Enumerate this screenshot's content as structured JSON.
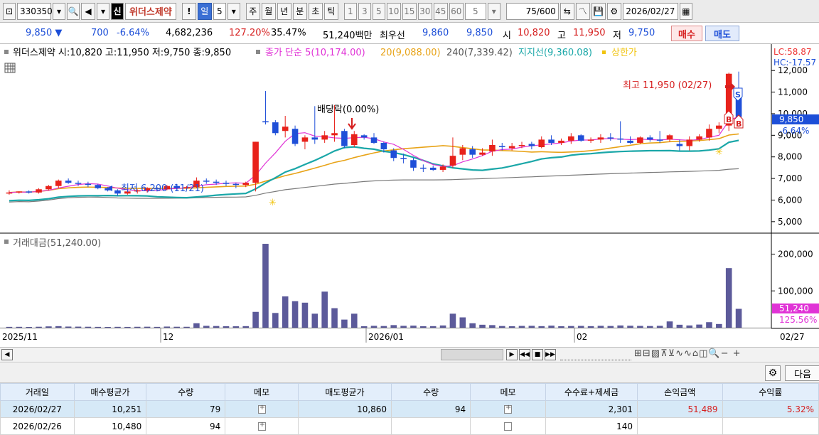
{
  "toolbar": {
    "code": "330350",
    "market_badge": "신",
    "stock_name": "위더스제약",
    "alert": "!",
    "period_day": "일",
    "period_value": "5",
    "periods": [
      "주",
      "월",
      "년",
      "분",
      "초",
      "틱"
    ],
    "intervals": [
      "1",
      "3",
      "5",
      "10",
      "15",
      "30",
      "45",
      "60"
    ],
    "custom_interval": "5",
    "count": "75",
    "count_total": "/600",
    "date": "2026/02/27"
  },
  "price": {
    "current": "9,850",
    "change": "700",
    "change_pct": "-6.64%",
    "volume": "4,682,236",
    "volume_ratio": "127.20%",
    "turnover": "35.47%",
    "amount": "51,240백만",
    "ask_label": "최우선",
    "ask": "9,860",
    "bid": "9,850",
    "open_label": "시",
    "open": "10,820",
    "high_label": "고",
    "high": "11,950",
    "low_label": "저",
    "low": "9,750",
    "buy_button": "매수",
    "sell_button": "매도"
  },
  "chart": {
    "header_name": "위더스제약 시:10,820 고:11,950 저:9,750 종:9,850",
    "legend_ma": "종가 단순 5(10,174.00)",
    "legend_ma20": "20(9,088.00)",
    "legend_ma240": "240(7,339.42)",
    "legend_support": "지지선(9,360.08)",
    "legend_upper": "상한가",
    "lc": "LC:58.87",
    "hc": "HC:-17.57",
    "annotation_high": "최고 11,950 (02/27)",
    "annotation_low": "최저 6,200 (11/21)",
    "annotation_dividend": "배당락(0.00%)",
    "price_tag": "9,850",
    "price_tag_pct": "-6.64%",
    "volume_header": "거래대금(51,240.00)",
    "volume_tag": "51,240",
    "volume_tag_pct": "125.56%",
    "x_last_label": "02/27",
    "colors": {
      "up": "#e8221b",
      "down": "#1f4fd8",
      "ma5": "#e033d6",
      "ma20": "#e8a317",
      "ma240": "#7a7a7a",
      "support": "#1aa7a8",
      "volume": "#5c5a9a"
    }
  },
  "chart_data": {
    "type": "candlestick",
    "price_axis_ticks": [
      "12,000",
      "11,000",
      "10,000",
      "9,000",
      "8,000",
      "7,000",
      "6,000",
      "5,000"
    ],
    "price_ylim": [
      4600,
      12500
    ],
    "volume_axis_ticks": [
      "200,000",
      "100,000"
    ],
    "volume_ylim": [
      0,
      230000
    ],
    "x_labels": [
      "2025/11",
      "12",
      "2026/01",
      "02"
    ],
    "candles": [
      [
        6350,
        6450,
        6250,
        6350
      ],
      [
        6350,
        6400,
        6300,
        6400
      ],
      [
        6400,
        6450,
        6300,
        6350
      ],
      [
        6350,
        6550,
        6300,
        6500
      ],
      [
        6500,
        6700,
        6450,
        6650
      ],
      [
        6650,
        6950,
        6550,
        6900
      ],
      [
        6900,
        7000,
        6750,
        6800
      ],
      [
        6800,
        6900,
        6650,
        6750
      ],
      [
        6750,
        6850,
        6600,
        6700
      ],
      [
        6700,
        6750,
        6500,
        6550
      ],
      [
        6550,
        6600,
        6400,
        6450
      ],
      [
        6450,
        6500,
        6200,
        6300
      ],
      [
        6300,
        6450,
        6250,
        6400
      ],
      [
        6400,
        6500,
        6300,
        6450
      ],
      [
        6450,
        6600,
        6350,
        6550
      ],
      [
        6550,
        6600,
        6400,
        6500
      ],
      [
        6500,
        6700,
        6450,
        6650
      ],
      [
        6650,
        6750,
        6500,
        6550
      ],
      [
        6550,
        6650,
        6450,
        6600
      ],
      [
        6600,
        7050,
        6550,
        6900
      ],
      [
        6900,
        7000,
        6750,
        6850
      ],
      [
        6850,
        6950,
        6700,
        6800
      ],
      [
        6800,
        6900,
        6650,
        6750
      ],
      [
        6750,
        6800,
        6550,
        6700
      ],
      [
        6700,
        6850,
        6600,
        6800
      ],
      [
        6800,
        8700,
        6400,
        8700
      ],
      [
        9650,
        11050,
        9500,
        9600
      ],
      [
        9600,
        9700,
        9000,
        9100
      ],
      [
        9200,
        9900,
        8900,
        9400
      ],
      [
        9300,
        9450,
        8500,
        8600
      ],
      [
        8700,
        9000,
        8350,
        8900
      ],
      [
        8900,
        10350,
        8600,
        8800
      ],
      [
        8800,
        9200,
        8650,
        9000
      ],
      [
        9000,
        10400,
        8700,
        9100
      ],
      [
        9200,
        9300,
        8400,
        8500
      ],
      [
        8550,
        9200,
        8450,
        9050
      ],
      [
        9000,
        9050,
        8800,
        8900
      ],
      [
        8900,
        9100,
        8600,
        8650
      ],
      [
        8650,
        8700,
        8200,
        8350
      ],
      [
        8300,
        8400,
        7800,
        7950
      ],
      [
        7950,
        8150,
        7700,
        7900
      ],
      [
        7850,
        7950,
        7350,
        7500
      ],
      [
        7500,
        7650,
        7300,
        7450
      ],
      [
        7500,
        7600,
        7350,
        7400
      ],
      [
        7400,
        7650,
        7300,
        7550
      ],
      [
        7600,
        8900,
        7500,
        8050
      ],
      [
        8100,
        8550,
        7850,
        8400
      ],
      [
        8350,
        8500,
        7950,
        8100
      ],
      [
        8100,
        8400,
        8050,
        8200
      ],
      [
        8250,
        8800,
        8050,
        8550
      ],
      [
        8500,
        8650,
        8300,
        8450
      ],
      [
        8400,
        8650,
        8300,
        8500
      ],
      [
        8500,
        8700,
        8400,
        8550
      ],
      [
        8600,
        8700,
        8350,
        8500
      ],
      [
        8450,
        8950,
        8400,
        8800
      ],
      [
        8800,
        9000,
        8550,
        8650
      ],
      [
        8650,
        8850,
        8550,
        8750
      ],
      [
        8750,
        9100,
        8600,
        8950
      ],
      [
        9000,
        9050,
        8700,
        8750
      ],
      [
        8750,
        8900,
        8650,
        8800
      ],
      [
        8800,
        9050,
        8650,
        8900
      ],
      [
        8900,
        9100,
        8750,
        8850
      ],
      [
        8850,
        9650,
        8650,
        8800
      ],
      [
        8750,
        8950,
        8600,
        8650
      ],
      [
        8650,
        8950,
        8600,
        8900
      ],
      [
        8900,
        9000,
        8700,
        8800
      ],
      [
        8800,
        9200,
        8650,
        8750
      ],
      [
        8800,
        9050,
        8700,
        9000
      ],
      [
        8600,
        8800,
        8300,
        8500
      ],
      [
        8500,
        8950,
        8300,
        8800
      ],
      [
        8800,
        9050,
        8700,
        8950
      ],
      [
        8900,
        9500,
        8750,
        9300
      ],
      [
        9300,
        9600,
        9100,
        9450
      ],
      [
        9450,
        11900,
        9200,
        11850
      ],
      [
        10820,
        11950,
        9750,
        9850
      ]
    ],
    "volume": [
      2200,
      2300,
      2000,
      2500,
      3500,
      4200,
      3000,
      2800,
      2500,
      2200,
      2000,
      2300,
      2100,
      2400,
      2600,
      2200,
      3000,
      2500,
      2400,
      12000,
      5000,
      4500,
      4000,
      3800,
      4200,
      43000,
      228000,
      40000,
      85000,
      72000,
      68000,
      38000,
      98000,
      53000,
      22000,
      38000,
      4000,
      5000,
      4500,
      7000,
      5000,
      5500,
      4000,
      4200,
      6000,
      38000,
      28000,
      12000,
      8000,
      7000,
      4500,
      4000,
      4800,
      5000,
      4200,
      5500,
      4000,
      4500,
      4800,
      4200,
      5000,
      4600,
      6000,
      5200,
      4800,
      4500,
      5000,
      17000,
      8000,
      6000,
      8500,
      15000,
      10000,
      162000,
      51240
    ]
  },
  "trades": {
    "headers": [
      "거래일",
      "매수평균가",
      "수량",
      "메모",
      "매도평균가",
      "수량",
      "메모",
      "수수료+제세금",
      "손익금액",
      "수익률"
    ],
    "rows": [
      {
        "date": "2026/02/27",
        "buy_avg": "10,251",
        "buy_qty": "79",
        "sell_avg": "10,860",
        "sell_qty": "94",
        "fee": "2,301",
        "pnl": "51,489",
        "ret": "5.32%"
      },
      {
        "date": "2026/02/26",
        "buy_avg": "10,480",
        "buy_qty": "94",
        "sell_avg": "",
        "sell_qty": "",
        "fee": "140",
        "pnl": "",
        "ret": ""
      }
    ],
    "next_button": "다음"
  }
}
